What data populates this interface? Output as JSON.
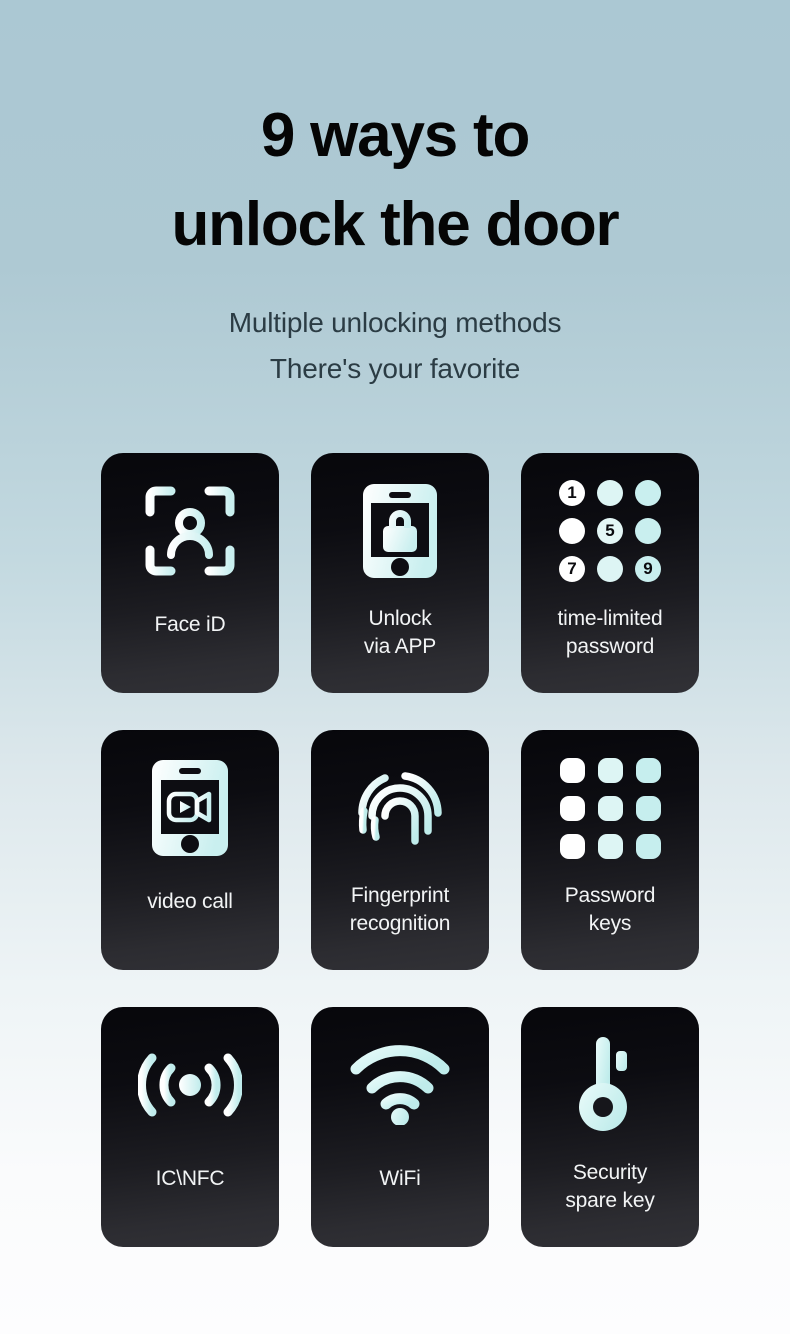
{
  "header": {
    "title_line1": "9 ways to",
    "title_line2": "unlock the door",
    "subtitle_line1": "Multiple unlocking methods",
    "subtitle_line2": "There's your favorite"
  },
  "colors": {
    "bg_top": "#abc8d3",
    "bg_mid": "#dde8ec",
    "bg_bottom": "#fdfdfe",
    "card_top": "#07070b",
    "card_bottom": "#313136",
    "card_text": "#f2f4f5",
    "icon_white": "#ffffff",
    "icon_cyan": "#c9efef",
    "title_text": "#050505",
    "subtitle_text": "#2b3c44"
  },
  "cards": [
    {
      "id": "face-id",
      "icon": "face-id-scan-icon",
      "label_line1": "Face iD",
      "label_line2": ""
    },
    {
      "id": "unlock-app",
      "icon": "phone-lock-icon",
      "label_line1": "Unlock",
      "label_line2": "via APP"
    },
    {
      "id": "time-password",
      "icon": "numeric-keypad-icon",
      "label_line1": "time-limited",
      "label_line2": "password"
    },
    {
      "id": "video-call",
      "icon": "phone-video-camera-icon",
      "label_line1": "video call",
      "label_line2": ""
    },
    {
      "id": "fingerprint",
      "icon": "fingerprint-icon",
      "label_line1": "Fingerprint",
      "label_line2": "recognition"
    },
    {
      "id": "password-keys",
      "icon": "keypad-dots-icon",
      "label_line1": "Password",
      "label_line2": "keys"
    },
    {
      "id": "ic-nfc",
      "icon": "nfc-waves-icon",
      "label_line1": "IC\\NFC",
      "label_line2": ""
    },
    {
      "id": "wifi",
      "icon": "wifi-icon",
      "label_line1": "WiFi",
      "label_line2": ""
    },
    {
      "id": "spare-key",
      "icon": "key-icon",
      "label_line1": "Security",
      "label_line2": "spare key"
    }
  ],
  "keypad_time_limited": {
    "keys": [
      "1",
      "",
      "",
      "",
      "5",
      "",
      "7",
      "",
      "9"
    ]
  },
  "keypad_password_keys": {
    "keys": [
      "",
      "",
      "",
      "",
      "",
      "",
      "",
      "",
      ""
    ]
  }
}
